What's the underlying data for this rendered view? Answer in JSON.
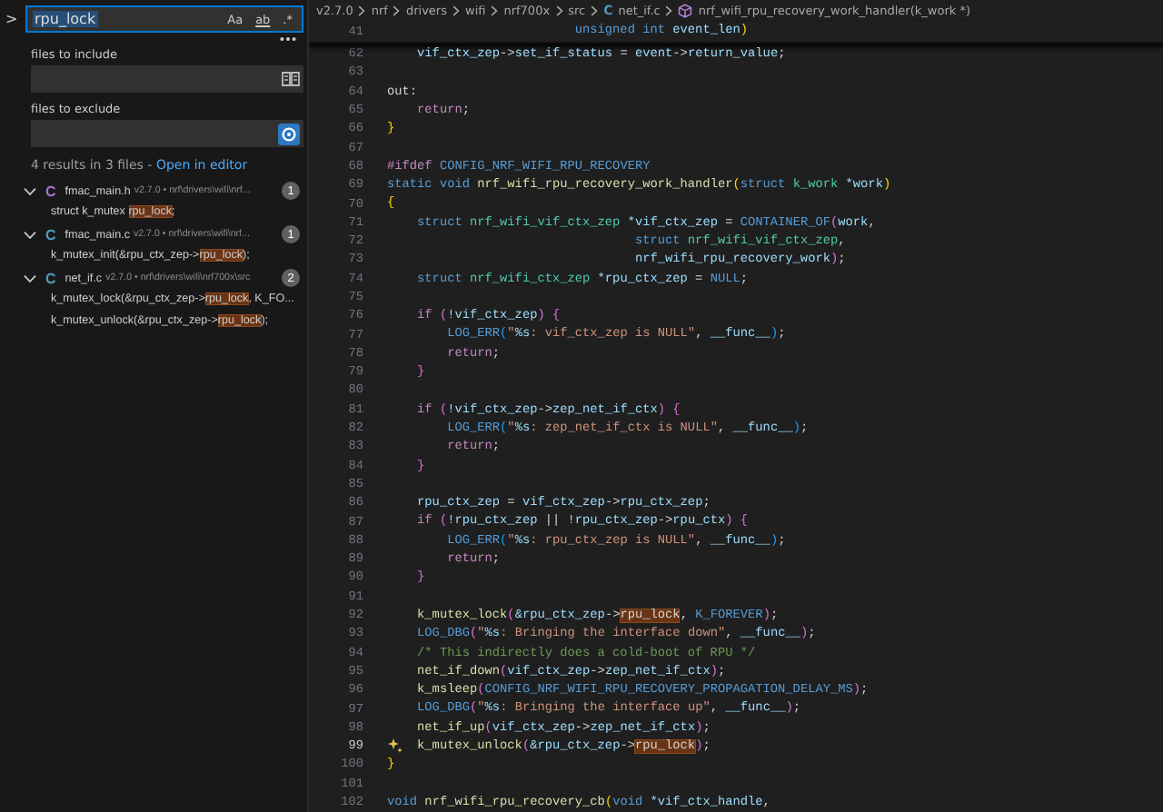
{
  "search": {
    "toggle_label": ">",
    "query": "rpu_lock",
    "query_selected": true,
    "options": [
      {
        "label": "Aa",
        "kind": "case",
        "on": false
      },
      {
        "label": "ab",
        "kind": "word",
        "on": false
      },
      {
        "label": ".*",
        "kind": "regex",
        "on": false
      }
    ],
    "include_label": "files to include",
    "exclude_label": "files to exclude",
    "exclude_settings_on": true,
    "summary": "4 results in 3 files - ",
    "open_link": "Open in editor",
    "files": [
      {
        "icon_label": "C",
        "color": "#a074c4",
        "name": "fmac_main.h",
        "path": "v2.7.0 • nrf\\drivers\\wifi\\nrf...",
        "count": "1",
        "expanded": true,
        "matches": [
          {
            "before": "struct k_mutex ",
            "match": "rpu_lock",
            "after": ";"
          }
        ]
      },
      {
        "icon_label": "C",
        "color": "#519aba",
        "name": "fmac_main.c",
        "path": "v2.7.0 • nrf\\drivers\\wifi\\nrf...",
        "count": "1",
        "expanded": true,
        "matches": [
          {
            "before": "k_mutex_init(&rpu_ctx_zep->",
            "match": "rpu_lock",
            "after": ");"
          }
        ]
      },
      {
        "icon_label": "C",
        "color": "#519aba",
        "name": "net_if.c",
        "path": "v2.7.0 • nrf\\drivers\\wifi\\nrf700x\\src",
        "count": "2",
        "expanded": true,
        "matches": [
          {
            "before": "k_mutex_lock(&rpu_ctx_zep->",
            "match": "rpu_lock",
            "after": ", K_FO..."
          },
          {
            "before": "k_mutex_unlock(&rpu_ctx_zep->",
            "match": "rpu_lock",
            "after": ");"
          }
        ]
      }
    ]
  },
  "breadcrumbs": [
    {
      "kind": "folder",
      "label": "v2.7.0"
    },
    {
      "kind": "folder",
      "label": "nrf"
    },
    {
      "kind": "folder",
      "label": "drivers"
    },
    {
      "kind": "folder",
      "label": "wifi"
    },
    {
      "kind": "folder",
      "label": "nrf700x"
    },
    {
      "kind": "folder",
      "label": "src"
    },
    {
      "kind": "file",
      "icon_label": "C",
      "label": "net_if.c"
    },
    {
      "kind": "symbol",
      "label": "nrf_wifi_rpu_recovery_work_handler(k_work *)"
    }
  ],
  "sticky_line": {
    "number": "41",
    "tokens": [
      {
        "text": "                         unsigned",
        "kind": "kw"
      },
      {
        "text": " int",
        "kind": "kw"
      },
      {
        "text": " event_len",
        "kind": "var"
      },
      {
        "text": ")",
        "kind": "br1"
      }
    ]
  },
  "lines": [
    {
      "number": "62",
      "current": false,
      "tokens": [
        {
          "text": "    vif_ctx_zep",
          "kind": "var"
        },
        {
          "text": "->",
          "kind": "plain"
        },
        {
          "text": "set_if_status",
          "kind": "var"
        },
        {
          "text": " = ",
          "kind": "plain"
        },
        {
          "text": "event",
          "kind": "var"
        },
        {
          "text": "->",
          "kind": "plain"
        },
        {
          "text": "return_value",
          "kind": "var"
        },
        {
          "text": ";",
          "kind": "plain"
        }
      ]
    },
    {
      "number": "63",
      "current": false
    },
    {
      "number": "64",
      "current": false,
      "tokens": [
        {
          "text": "out:",
          "kind": "plain"
        }
      ]
    },
    {
      "number": "65",
      "current": false,
      "tokens": [
        {
          "text": "    return",
          "kind": "ctrl"
        },
        {
          "text": ";",
          "kind": "plain"
        }
      ]
    },
    {
      "number": "66",
      "current": false,
      "tokens": [
        {
          "text": "}",
          "kind": "br1"
        }
      ]
    },
    {
      "number": "67",
      "current": false
    },
    {
      "number": "68",
      "current": false,
      "tokens": [
        {
          "text": "#ifdef",
          "kind": "pre"
        },
        {
          "text": " CONFIG_NRF_WIFI_RPU_RECOVERY",
          "kind": "macro"
        }
      ]
    },
    {
      "number": "69",
      "current": false,
      "tokens": [
        {
          "text": "static void",
          "kind": "kw"
        },
        {
          "text": " nrf_wifi_rpu_recovery_work_handler",
          "kind": "fn"
        },
        {
          "text": "(",
          "kind": "br1"
        },
        {
          "text": "struct",
          "kind": "kw"
        },
        {
          "text": " k_work",
          "kind": "type"
        },
        {
          "text": " *work",
          "kind": "var"
        },
        {
          "text": ")",
          "kind": "br1"
        }
      ]
    },
    {
      "number": "70",
      "current": false,
      "tokens": [
        {
          "text": "{",
          "kind": "br1"
        }
      ]
    },
    {
      "number": "71",
      "current": false,
      "tokens": [
        {
          "text": "    struct",
          "kind": "kw"
        },
        {
          "text": " nrf_wifi_vif_ctx_zep",
          "kind": "type"
        },
        {
          "text": " *vif_ctx_zep",
          "kind": "var"
        },
        {
          "text": " = ",
          "kind": "plain"
        },
        {
          "text": "CONTAINER_OF",
          "kind": "macro"
        },
        {
          "text": "(",
          "kind": "br2"
        },
        {
          "text": "work",
          "kind": "var"
        },
        {
          "text": ",",
          "kind": "plain"
        }
      ]
    },
    {
      "number": "72",
      "current": false,
      "tokens": [
        {
          "text": "                                 struct",
          "kind": "kw"
        },
        {
          "text": " nrf_wifi_vif_ctx_zep",
          "kind": "type"
        },
        {
          "text": ",",
          "kind": "plain"
        }
      ]
    },
    {
      "number": "73",
      "current": false,
      "tokens": [
        {
          "text": "                                 nrf_wifi_rpu_recovery_work",
          "kind": "var"
        },
        {
          "text": ")",
          "kind": "br2"
        },
        {
          "text": ";",
          "kind": "plain"
        }
      ]
    },
    {
      "number": "74",
      "current": false,
      "tokens": [
        {
          "text": "    struct",
          "kind": "kw"
        },
        {
          "text": " nrf_wifi_ctx_zep",
          "kind": "type"
        },
        {
          "text": " *rpu_ctx_zep",
          "kind": "var"
        },
        {
          "text": " = ",
          "kind": "plain"
        },
        {
          "text": "NULL",
          "kind": "kw"
        },
        {
          "text": ";",
          "kind": "plain"
        }
      ]
    },
    {
      "number": "75",
      "current": false
    },
    {
      "number": "76",
      "current": false,
      "tokens": [
        {
          "text": "    if",
          "kind": "ctrl"
        },
        {
          "text": " (",
          "kind": "br2"
        },
        {
          "text": "!vif_ctx_zep",
          "kind": "var"
        },
        {
          "text": ")",
          "kind": "br2"
        },
        {
          "text": " {",
          "kind": "br2"
        }
      ]
    },
    {
      "number": "77",
      "current": false,
      "tokens": [
        {
          "text": "        LOG_ERR",
          "kind": "macro"
        },
        {
          "text": "(",
          "kind": "br3"
        },
        {
          "text": "\"",
          "kind": "str"
        },
        {
          "text": "%s",
          "kind": "fmt"
        },
        {
          "text": ": vif_ctx_zep is NULL\"",
          "kind": "str"
        },
        {
          "text": ", ",
          "kind": "plain"
        },
        {
          "text": "__func__",
          "kind": "var"
        },
        {
          "text": ")",
          "kind": "br3"
        },
        {
          "text": ";",
          "kind": "plain"
        }
      ]
    },
    {
      "number": "78",
      "current": false,
      "tokens": [
        {
          "text": "        return",
          "kind": "ctrl"
        },
        {
          "text": ";",
          "kind": "plain"
        }
      ]
    },
    {
      "number": "79",
      "current": false,
      "tokens": [
        {
          "text": "    }",
          "kind": "br2"
        }
      ]
    },
    {
      "number": "80",
      "current": false
    },
    {
      "number": "81",
      "current": false,
      "tokens": [
        {
          "text": "    if",
          "kind": "ctrl"
        },
        {
          "text": " (",
          "kind": "br2"
        },
        {
          "text": "!vif_ctx_zep",
          "kind": "var"
        },
        {
          "text": "->",
          "kind": "plain"
        },
        {
          "text": "zep_net_if_ctx",
          "kind": "var"
        },
        {
          "text": ")",
          "kind": "br2"
        },
        {
          "text": " {",
          "kind": "br2"
        }
      ]
    },
    {
      "number": "82",
      "current": false,
      "tokens": [
        {
          "text": "        LOG_ERR",
          "kind": "macro"
        },
        {
          "text": "(",
          "kind": "br3"
        },
        {
          "text": "\"",
          "kind": "str"
        },
        {
          "text": "%s",
          "kind": "fmt"
        },
        {
          "text": ": zep_net_if_ctx is NULL\"",
          "kind": "str"
        },
        {
          "text": ", ",
          "kind": "plain"
        },
        {
          "text": "__func__",
          "kind": "var"
        },
        {
          "text": ")",
          "kind": "br3"
        },
        {
          "text": ";",
          "kind": "plain"
        }
      ]
    },
    {
      "number": "83",
      "current": false,
      "tokens": [
        {
          "text": "        return",
          "kind": "ctrl"
        },
        {
          "text": ";",
          "kind": "plain"
        }
      ]
    },
    {
      "number": "84",
      "current": false,
      "tokens": [
        {
          "text": "    }",
          "kind": "br2"
        }
      ]
    },
    {
      "number": "85",
      "current": false
    },
    {
      "number": "86",
      "current": false,
      "tokens": [
        {
          "text": "    rpu_ctx_zep",
          "kind": "var"
        },
        {
          "text": " = ",
          "kind": "plain"
        },
        {
          "text": "vif_ctx_zep",
          "kind": "var"
        },
        {
          "text": "->",
          "kind": "plain"
        },
        {
          "text": "rpu_ctx_zep",
          "kind": "var"
        },
        {
          "text": ";",
          "kind": "plain"
        }
      ]
    },
    {
      "number": "87",
      "current": false,
      "tokens": [
        {
          "text": "    if",
          "kind": "ctrl"
        },
        {
          "text": " (",
          "kind": "br2"
        },
        {
          "text": "!rpu_ctx_zep",
          "kind": "var"
        },
        {
          "text": " || ",
          "kind": "plain"
        },
        {
          "text": "!rpu_ctx_zep",
          "kind": "var"
        },
        {
          "text": "->",
          "kind": "plain"
        },
        {
          "text": "rpu_ctx",
          "kind": "var"
        },
        {
          "text": ")",
          "kind": "br2"
        },
        {
          "text": " {",
          "kind": "br2"
        }
      ]
    },
    {
      "number": "88",
      "current": false,
      "tokens": [
        {
          "text": "        LOG_ERR",
          "kind": "macro"
        },
        {
          "text": "(",
          "kind": "br3"
        },
        {
          "text": "\"",
          "kind": "str"
        },
        {
          "text": "%s",
          "kind": "fmt"
        },
        {
          "text": ": rpu_ctx_zep is NULL\"",
          "kind": "str"
        },
        {
          "text": ", ",
          "kind": "plain"
        },
        {
          "text": "__func__",
          "kind": "var"
        },
        {
          "text": ")",
          "kind": "br3"
        },
        {
          "text": ";",
          "kind": "plain"
        }
      ]
    },
    {
      "number": "89",
      "current": false,
      "tokens": [
        {
          "text": "        return",
          "kind": "ctrl"
        },
        {
          "text": ";",
          "kind": "plain"
        }
      ]
    },
    {
      "number": "90",
      "current": false,
      "tokens": [
        {
          "text": "    }",
          "kind": "br2"
        }
      ]
    },
    {
      "number": "91",
      "current": false
    },
    {
      "number": "92",
      "current": false,
      "tokens": [
        {
          "text": "    k_mutex_lock",
          "kind": "fn"
        },
        {
          "text": "(",
          "kind": "br2"
        },
        {
          "text": "&rpu_ctx_zep",
          "kind": "var"
        },
        {
          "text": "->",
          "kind": "plain"
        },
        {
          "text": "rpu_lock",
          "kind": "match"
        },
        {
          "text": ", ",
          "kind": "plain"
        },
        {
          "text": "K_FOREVER",
          "kind": "macro"
        },
        {
          "text": ")",
          "kind": "br2"
        },
        {
          "text": ";",
          "kind": "plain"
        }
      ]
    },
    {
      "number": "93",
      "current": false,
      "tokens": [
        {
          "text": "    LOG_DBG",
          "kind": "macro"
        },
        {
          "text": "(",
          "kind": "br2"
        },
        {
          "text": "\"",
          "kind": "str"
        },
        {
          "text": "%s",
          "kind": "fmt"
        },
        {
          "text": ": Bringing the interface down\"",
          "kind": "str"
        },
        {
          "text": ", ",
          "kind": "plain"
        },
        {
          "text": "__func__",
          "kind": "var"
        },
        {
          "text": ")",
          "kind": "br2"
        },
        {
          "text": ";",
          "kind": "plain"
        }
      ]
    },
    {
      "number": "94",
      "current": false,
      "tokens": [
        {
          "text": "    /* This indirectly does a cold-boot of RPU */",
          "kind": "cmt"
        }
      ]
    },
    {
      "number": "95",
      "current": false,
      "tokens": [
        {
          "text": "    net_if_down",
          "kind": "fn"
        },
        {
          "text": "(",
          "kind": "br2"
        },
        {
          "text": "vif_ctx_zep",
          "kind": "var"
        },
        {
          "text": "->",
          "kind": "plain"
        },
        {
          "text": "zep_net_if_ctx",
          "kind": "var"
        },
        {
          "text": ")",
          "kind": "br2"
        },
        {
          "text": ";",
          "kind": "plain"
        }
      ]
    },
    {
      "number": "96",
      "current": false,
      "tokens": [
        {
          "text": "    k_msleep",
          "kind": "fn"
        },
        {
          "text": "(",
          "kind": "br2"
        },
        {
          "text": "CONFIG_NRF_WIFI_RPU_RECOVERY_PROPAGATION_DELAY_MS",
          "kind": "macro"
        },
        {
          "text": ")",
          "kind": "br2"
        },
        {
          "text": ";",
          "kind": "plain"
        }
      ]
    },
    {
      "number": "97",
      "current": false,
      "tokens": [
        {
          "text": "    LOG_DBG",
          "kind": "macro"
        },
        {
          "text": "(",
          "kind": "br2"
        },
        {
          "text": "\"",
          "kind": "str"
        },
        {
          "text": "%s",
          "kind": "fmt"
        },
        {
          "text": ": Bringing the interface up\"",
          "kind": "str"
        },
        {
          "text": ", ",
          "kind": "plain"
        },
        {
          "text": "__func__",
          "kind": "var"
        },
        {
          "text": ")",
          "kind": "br2"
        },
        {
          "text": ";",
          "kind": "plain"
        }
      ]
    },
    {
      "number": "98",
      "current": false,
      "tokens": [
        {
          "text": "    net_if_up",
          "kind": "fn"
        },
        {
          "text": "(",
          "kind": "br2"
        },
        {
          "text": "vif_ctx_zep",
          "kind": "var"
        },
        {
          "text": "->",
          "kind": "plain"
        },
        {
          "text": "zep_net_if_ctx",
          "kind": "var"
        },
        {
          "text": ")",
          "kind": "br2"
        },
        {
          "text": ";",
          "kind": "plain"
        }
      ]
    },
    {
      "number": "99",
      "current": true,
      "tokens": [
        {
          "text": "    k_mutex_unlock",
          "kind": "fn"
        },
        {
          "text": "(",
          "kind": "br2"
        },
        {
          "text": "&rpu_ctx_zep",
          "kind": "var"
        },
        {
          "text": "->",
          "kind": "plain"
        },
        {
          "text": "rpu_lock",
          "kind": "match"
        },
        {
          "text": ")",
          "kind": "br2"
        },
        {
          "text": ";",
          "kind": "plain"
        }
      ]
    },
    {
      "number": "100",
      "current": false,
      "tokens": [
        {
          "text": "}",
          "kind": "br1"
        }
      ]
    },
    {
      "number": "101",
      "current": false
    },
    {
      "number": "102",
      "current": false,
      "tokens": [
        {
          "text": "void",
          "kind": "kw"
        },
        {
          "text": " nrf_wifi_rpu_recovery_cb",
          "kind": "fn"
        },
        {
          "text": "(",
          "kind": "br1"
        },
        {
          "text": "void",
          "kind": "kw"
        },
        {
          "text": " *vif_ctx_handle",
          "kind": "var"
        },
        {
          "text": ",",
          "kind": "plain"
        }
      ]
    }
  ]
}
